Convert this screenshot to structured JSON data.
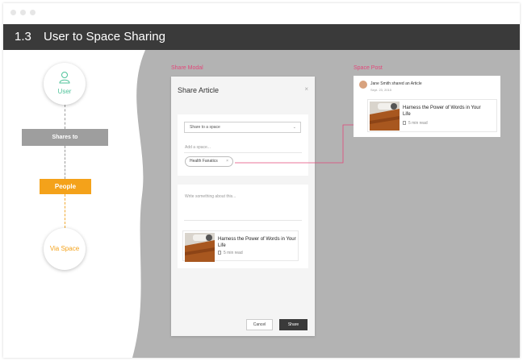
{
  "header": {
    "section_number": "1.3",
    "title": "User to Space Sharing"
  },
  "flow": {
    "user_label": "User",
    "shares_to": "Shares to",
    "people": "People",
    "via_space": "Via Space"
  },
  "labels": {
    "share_modal": "Share Modal",
    "space_post": "Space Post"
  },
  "modal": {
    "title": "Share Article",
    "close": "×",
    "select_value": "Share to a space",
    "select_chevron": "⌄",
    "add_space_placeholder": "Add a space...",
    "tag": "Health Fanatics",
    "tag_remove": "×",
    "message_placeholder": "Write something about this...",
    "cancel": "Cancel",
    "share": "Share"
  },
  "article": {
    "title": "Harness the Power of Words in Your Life",
    "read_time": "5 min read"
  },
  "post": {
    "author_line": "Jane Smith shared an Article",
    "date": "Sept. 23, 2015"
  },
  "colors": {
    "accent_orange": "#f4a21a",
    "user_green": "#4fc39a",
    "label_pink": "#e2487a",
    "header_dark": "#3a3a3a"
  }
}
